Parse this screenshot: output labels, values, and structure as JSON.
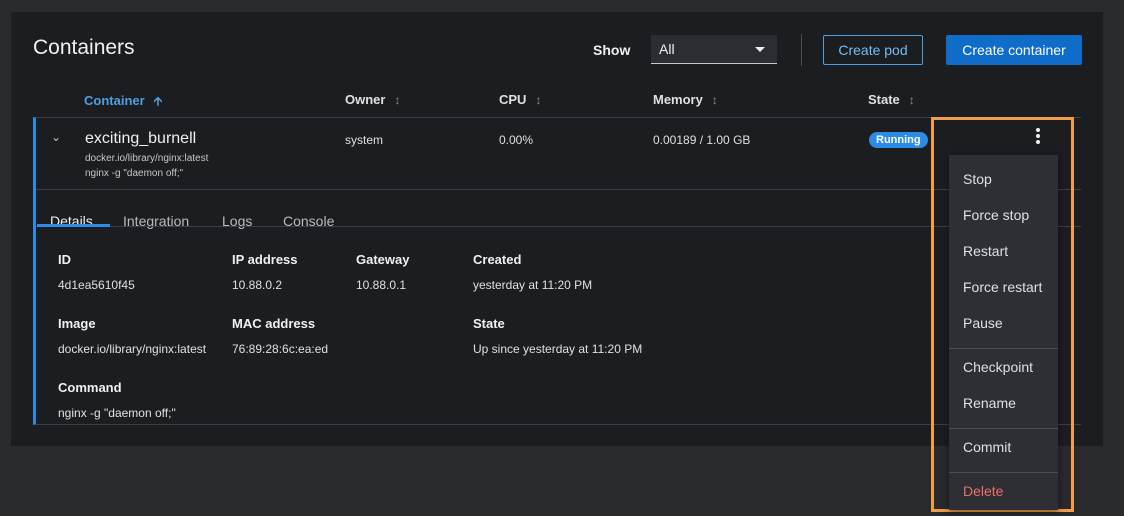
{
  "header": {
    "title": "Containers",
    "show_label": "Show",
    "show_value": "All",
    "create_pod": "Create pod",
    "create_container": "Create container"
  },
  "columns": [
    "Container",
    "Owner",
    "CPU",
    "Memory",
    "State"
  ],
  "container": {
    "name": "exciting_burnell",
    "image": "docker.io/library/nginx:latest",
    "command": "nginx -g \"daemon off;\"",
    "owner": "system",
    "cpu": "0.00%",
    "memory": "0.00189 / 1.00 GB",
    "state": "Running"
  },
  "tabs": [
    "Details",
    "Integration",
    "Logs",
    "Console"
  ],
  "details": {
    "id_label": "ID",
    "id": "4d1ea5610f45",
    "ip_label": "IP address",
    "ip": "10.88.0.2",
    "gateway_label": "Gateway",
    "gateway": "10.88.0.1",
    "created_label": "Created",
    "created": "yesterday at 11:20 PM",
    "image_label": "Image",
    "image": "docker.io/library/nginx:latest",
    "mac_label": "MAC address",
    "mac": "76:89:28:6c:ea:ed",
    "state_label": "State",
    "state": "Up since yesterday at 11:20 PM",
    "command_label": "Command",
    "command": "nginx -g \"daemon off;\""
  },
  "menu": [
    "Stop",
    "Force stop",
    "Restart",
    "Force restart",
    "Pause",
    "Checkpoint",
    "Rename",
    "Commit",
    "Delete"
  ],
  "colors": {
    "accent": "#2b8be6",
    "danger": "#e8726b",
    "highlight": "#f29d48"
  }
}
